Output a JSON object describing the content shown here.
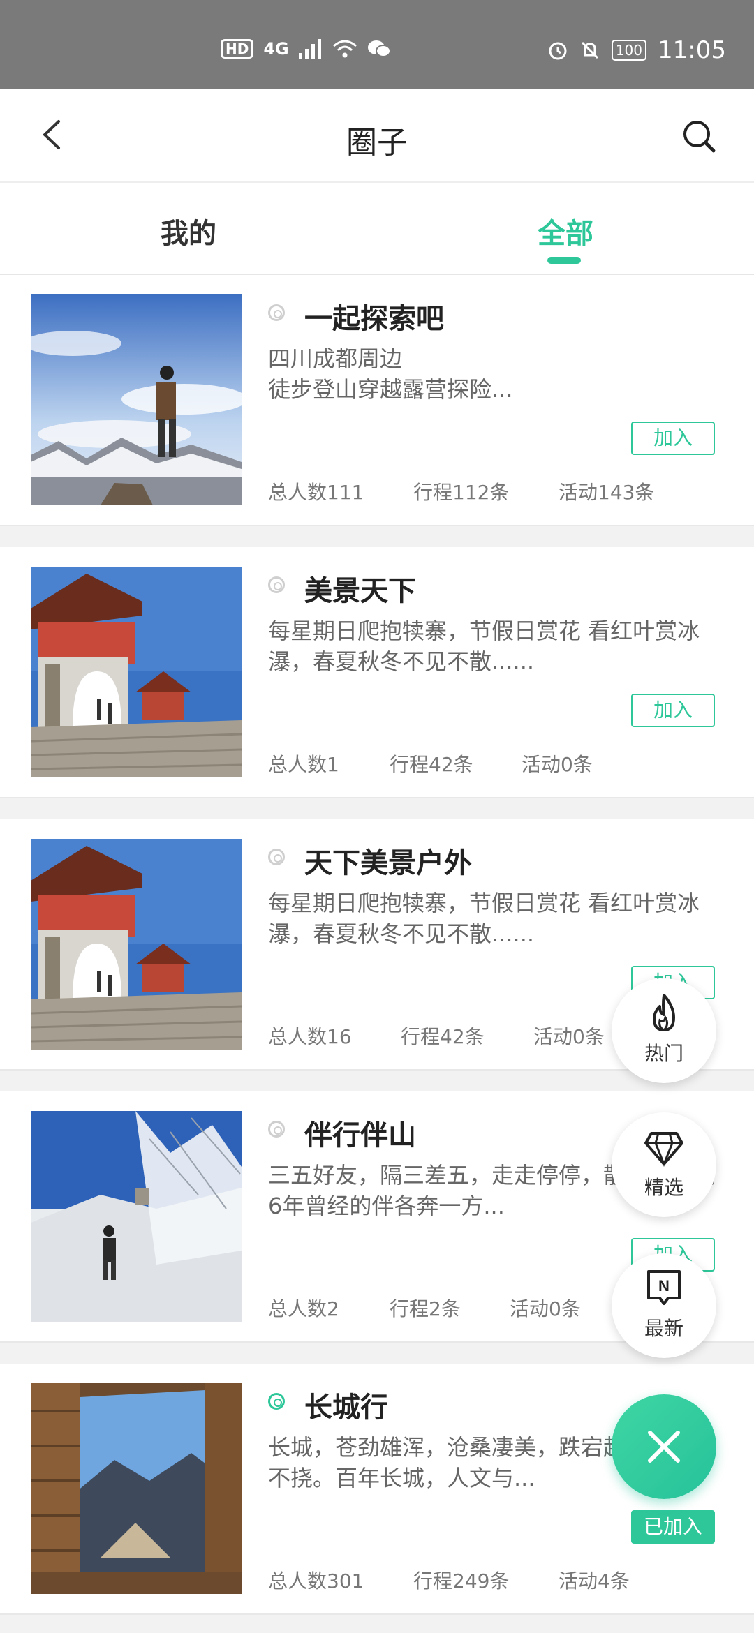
{
  "status_bar": {
    "badge": "HD",
    "network": "4G",
    "battery": "100",
    "time": "11:05"
  },
  "header": {
    "title": "圈子"
  },
  "tabs": [
    {
      "label": "我的"
    },
    {
      "label": "全部"
    }
  ],
  "cards": [
    {
      "name": "一起探索吧",
      "desc": "四川成都周边\n徒步登山穿越露营探险...",
      "join": "加入",
      "members": "总人数111",
      "trips": "行程112条",
      "activities": "活动143条"
    },
    {
      "name": "美景天下",
      "desc": "每星期日爬抱犊寨，节假日赏花 看红叶赏冰瀑，春夏秋冬不见不散......",
      "join": "加入",
      "members": "总人数1",
      "trips": "行程42条",
      "activities": "活动0条"
    },
    {
      "name": "天下美景户外",
      "desc": "每星期日爬抱犊寨，节假日赏花 看红叶赏冰瀑，春夏秋冬不见不散......",
      "join": "加入",
      "members": "总人数16",
      "trips": "行程42条",
      "activities": "活动0条"
    },
    {
      "name": "伴行伴山",
      "desc": "三五好友，隔三差五，走走停停，散散。时隔6年曾经的伴各奔一方...",
      "join": "加入",
      "members": "总人数2",
      "trips": "行程2条",
      "activities": "活动0条"
    },
    {
      "name": "长城行",
      "desc": "长城，苍劲雄浑，沧桑凄美，跌宕起伏，百折不挠。百年长城，人文与...",
      "join": "已加入",
      "members": "总人数301",
      "trips": "行程249条",
      "activities": "活动4条"
    }
  ],
  "fabs": {
    "hot": "热门",
    "featured": "精选",
    "latest": "最新"
  }
}
